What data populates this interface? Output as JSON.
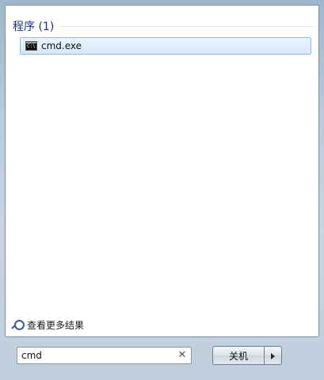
{
  "results": {
    "section_title": "程序 (1)",
    "items": [
      {
        "label": "cmd.exe",
        "icon": "command-prompt-icon"
      }
    ]
  },
  "see_more": {
    "label": "查看更多结果",
    "icon": "magnifier-icon"
  },
  "search": {
    "value": "cmd",
    "clear_icon": "clear-icon"
  },
  "power": {
    "shutdown_label": "关机",
    "arrow_icon": "chevron-right-icon"
  }
}
